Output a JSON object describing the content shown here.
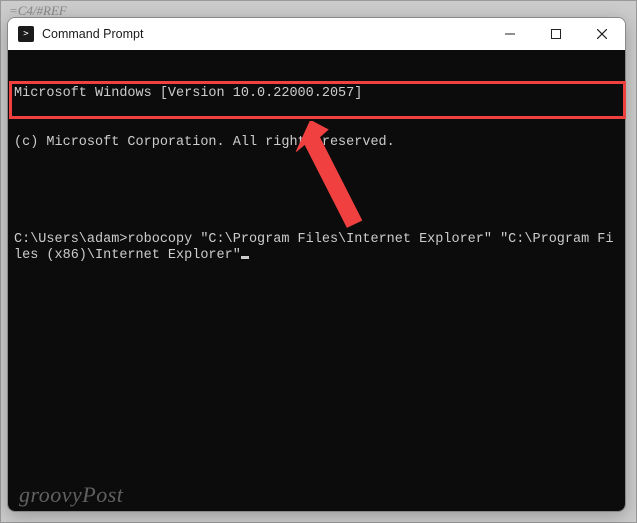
{
  "background": {
    "hint_text": "=C4/#REF"
  },
  "window": {
    "title": "Command Prompt",
    "icon_name": "cmd-icon",
    "controls": {
      "minimize": "minimize-icon",
      "maximize": "maximize-icon",
      "close": "close-icon"
    }
  },
  "terminal": {
    "lines": [
      "Microsoft Windows [Version 10.0.22000.2057]",
      "(c) Microsoft Corporation. All rights reserved."
    ],
    "prompt": "C:\\Users\\adam>",
    "command": "robocopy \"C:\\Program Files\\Internet Explorer\" \"C:\\Program Files (x86)\\Internet Explorer\"",
    "cursor": "_"
  },
  "annotations": {
    "highlight_color": "#f04040",
    "arrow_color": "#f04040"
  },
  "watermark": "groovyPost"
}
